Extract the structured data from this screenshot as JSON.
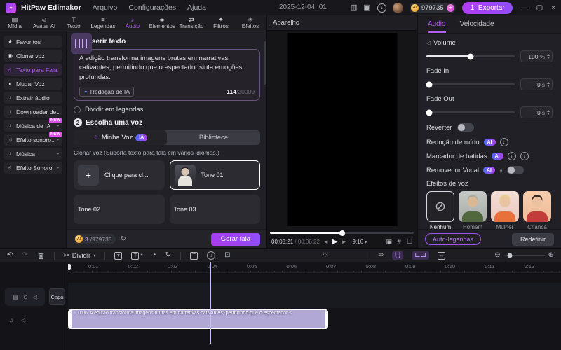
{
  "icons": {
    "logo": "✦",
    "layout": "▥",
    "feedback": "▣",
    "download": "↓",
    "plus": "+",
    "export": "↥",
    "minimize": "—",
    "maximize": "▢",
    "close": "×",
    "caret_down": "▾",
    "caret_up": "∧",
    "star_outline": "☆",
    "sparkle": "✦",
    "refresh": "↻",
    "prev": "◄",
    "play": "▶",
    "next": "►",
    "snapshot": "▣",
    "grid": "#",
    "fullscreen": "☐",
    "speaker": "◁",
    "voice": "♫",
    "film": "▤",
    "eye": "⊙",
    "note": "♪",
    "down": "↓",
    "info": "i",
    "undo": "↶",
    "redo": "↷",
    "scissors": "✂",
    "text_t": "T",
    "gauge": "◔",
    "loop": "↻",
    "frame_export": "⊡",
    "mic": "Ψ",
    "link": "∞",
    "magnet": "⋃",
    "brackets": "⊏⊐",
    "fit": "↔",
    "zoom_out": "⊖",
    "zoom_in": "⊕"
  },
  "labels": {
    "ai": "AI",
    "ia": "IA"
  },
  "titlebar": {
    "app_name": "HitPaw Edimakor",
    "menus": [
      "Arquivo",
      "Configurações",
      "Ajuda"
    ],
    "project_name": "2025-12-04_01",
    "credits": "979735",
    "export_label": "Exportar"
  },
  "media_tabs": [
    {
      "icon": "▤",
      "label": "Mídia"
    },
    {
      "icon": "☺",
      "label": "Avatar AI"
    },
    {
      "icon": "T",
      "label": "Texto"
    },
    {
      "icon": "≡",
      "label": "Legendas"
    },
    {
      "icon": "♪",
      "label": "Áudio",
      "active": true
    },
    {
      "icon": "◈",
      "label": "Elementos"
    },
    {
      "icon": "⇄",
      "label": "Transição"
    },
    {
      "icon": "✦",
      "label": "Filtros"
    },
    {
      "icon": "✳",
      "label": "Efeitos"
    }
  ],
  "sidebar": [
    {
      "icon": "★",
      "label": "Favoritos"
    },
    {
      "icon": "◉",
      "label": "Clonar voz"
    },
    {
      "icon": "♬",
      "label": "Texto para Fala",
      "active": true
    },
    {
      "icon": "◐",
      "label": "Mudar Voz"
    },
    {
      "icon": "♪",
      "label": "Extrair áudio"
    },
    {
      "icon": "↓",
      "label": "Downloader de..."
    },
    {
      "icon": "♪",
      "label": "Música de IA",
      "badge": "NEW",
      "arrow": "▾"
    },
    {
      "icon": "♫",
      "label": "Efeito sonoro...",
      "badge": "NEW",
      "arrow": "▾"
    },
    {
      "icon": "♪",
      "label": "Música",
      "arrow": "▾"
    },
    {
      "icon": "♬",
      "label": "Efeito Sonoro",
      "arrow": "▾"
    }
  ],
  "tts": {
    "step1_num": "1",
    "step1_label": "Inserir texto",
    "text_value": "A edição transforma imagens brutas em narrativas cativantes, permitindo que o espectador sinta emoções profundas.",
    "ai_writing_label": "Redação de IA",
    "char_count": "114",
    "char_max": "/20000",
    "split_label": "Dividir em legendas",
    "step2_num": "2",
    "step2_label": "Escolha uma voz",
    "tab_mine": "Minha Voz",
    "tab_library": "Biblioteca",
    "clone_hint": "Clonar voz (Suporta texto para fala em vários idiomas.)",
    "voice_add": "Clique para cl...",
    "tone1": "Tone 01",
    "tone2": "Tone 02",
    "tone3": "Tone 03",
    "favorites_label": "Favoritos",
    "quota_used": "3",
    "quota_total": "/979735",
    "generate_label": "Gerar fala"
  },
  "preview": {
    "title": "Aparelho",
    "current_time": "00:03:21",
    "time_sep": " / ",
    "total_time": "00:06:22",
    "ratio": "9:16"
  },
  "audio": {
    "tab_audio": "Áudio",
    "tab_speed": "Velocidade",
    "volume_label": "Volume",
    "volume_value": "100",
    "volume_unit": "%",
    "fade_in_label": "Fade In",
    "fade_in_value": "0",
    "fade_out_label": "Fade Out",
    "fade_out_value": "0",
    "fade_unit": "s",
    "reverse_label": "Reverter",
    "noise_label": "Redução de ruído",
    "beats_label": "Marcador de batidas",
    "vocal_label": "Removedor Vocal",
    "effects_title": "Efeitos de voz",
    "effects": [
      {
        "label": "Nenhum",
        "glyph": "⊘",
        "style_key": "none",
        "selected": true
      },
      {
        "label": "Homem",
        "style_key": "man"
      },
      {
        "label": "Mulher",
        "style_key": "woman"
      },
      {
        "label": "Criança",
        "style_key": "child"
      }
    ],
    "auto_captions_label": "Auto-legendas",
    "reset_label": "Redefinir"
  },
  "toolbar": {
    "split_label": "Dividir"
  },
  "timeline": {
    "cover_label": "Capa",
    "ruler": [
      "0:01",
      "0:02",
      "0:03",
      "0:04",
      "0:05",
      "0:06",
      "0:07",
      "0:08",
      "0:09",
      "0:10",
      "0:11",
      "0:12"
    ],
    "clip_duration": "0:06",
    "clip_text": "A edição transforma imagens brutas em narrativas cativantes, permitindo que o espectador s"
  }
}
